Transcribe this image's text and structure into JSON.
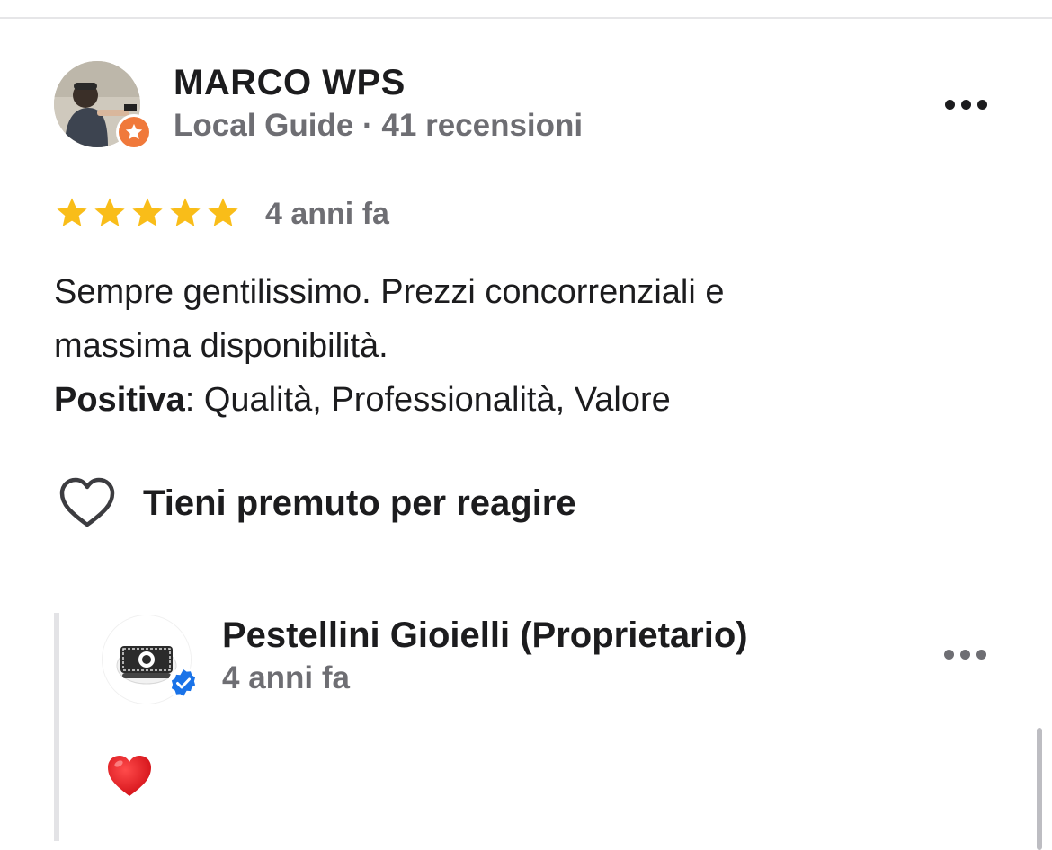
{
  "review": {
    "reviewer_name": "MARCO WPS",
    "reviewer_meta": "Local Guide · 41 recensioni",
    "rating": 5,
    "age": "4 anni fa",
    "text_line1": "Sempre gentilissimo. Prezzi concorrenziali e",
    "text_line2": "massima disponibilità.",
    "positive_label": "Positiva",
    "positive_values": ": Qualità, Professionalità, Valore"
  },
  "reaction": {
    "label": "Tieni premuto per reagire"
  },
  "owner_reply": {
    "name": "Pestellini Gioielli (Proprietario)",
    "age": "4 anni fa",
    "content_emoji": "red-heart-emoji"
  },
  "colors": {
    "star": "#f9bd19",
    "local_guide_badge": "#f0793b",
    "verified_badge": "#1a73e8",
    "secondary_text": "#6e6e73"
  },
  "icons": [
    "local-guide-star-icon",
    "more-options-icon",
    "heart-outline-icon",
    "verified-check-icon",
    "red-heart-emoji"
  ]
}
